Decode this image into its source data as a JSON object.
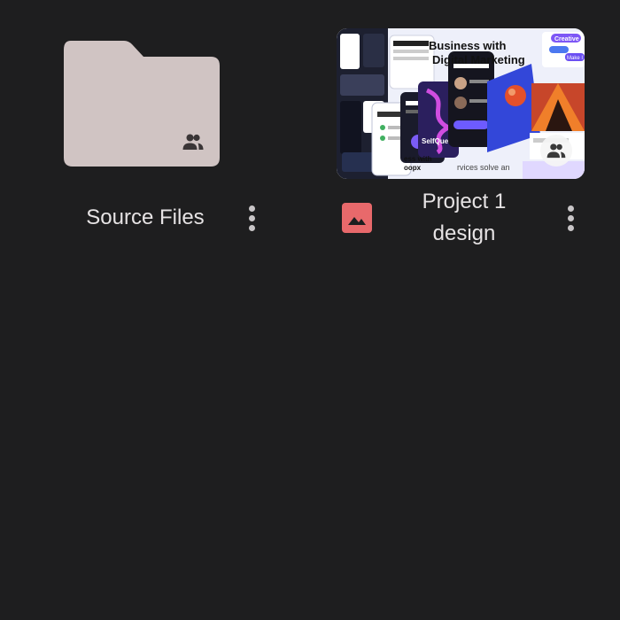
{
  "items": [
    {
      "name": "Source Files",
      "type": "folder",
      "shared": true,
      "folder_color": "#d0c4c3"
    },
    {
      "name": "Project 1 design",
      "type": "image",
      "shared": true,
      "type_icon_color": "#e8696b",
      "thumbnail": {
        "headline_line1": "Business with",
        "headline_line2": "Digital Marketing",
        "text_selfquest": "SelfQuest",
        "text_oopx": "oopx",
        "text_business_with": "ess with",
        "text_services": "rvices solve an",
        "text_creative": "Creative",
        "text_make": "Make I"
      }
    }
  ],
  "icons": {
    "shared": "people-icon",
    "more": "more-vert-icon",
    "image_type": "image-icon"
  }
}
